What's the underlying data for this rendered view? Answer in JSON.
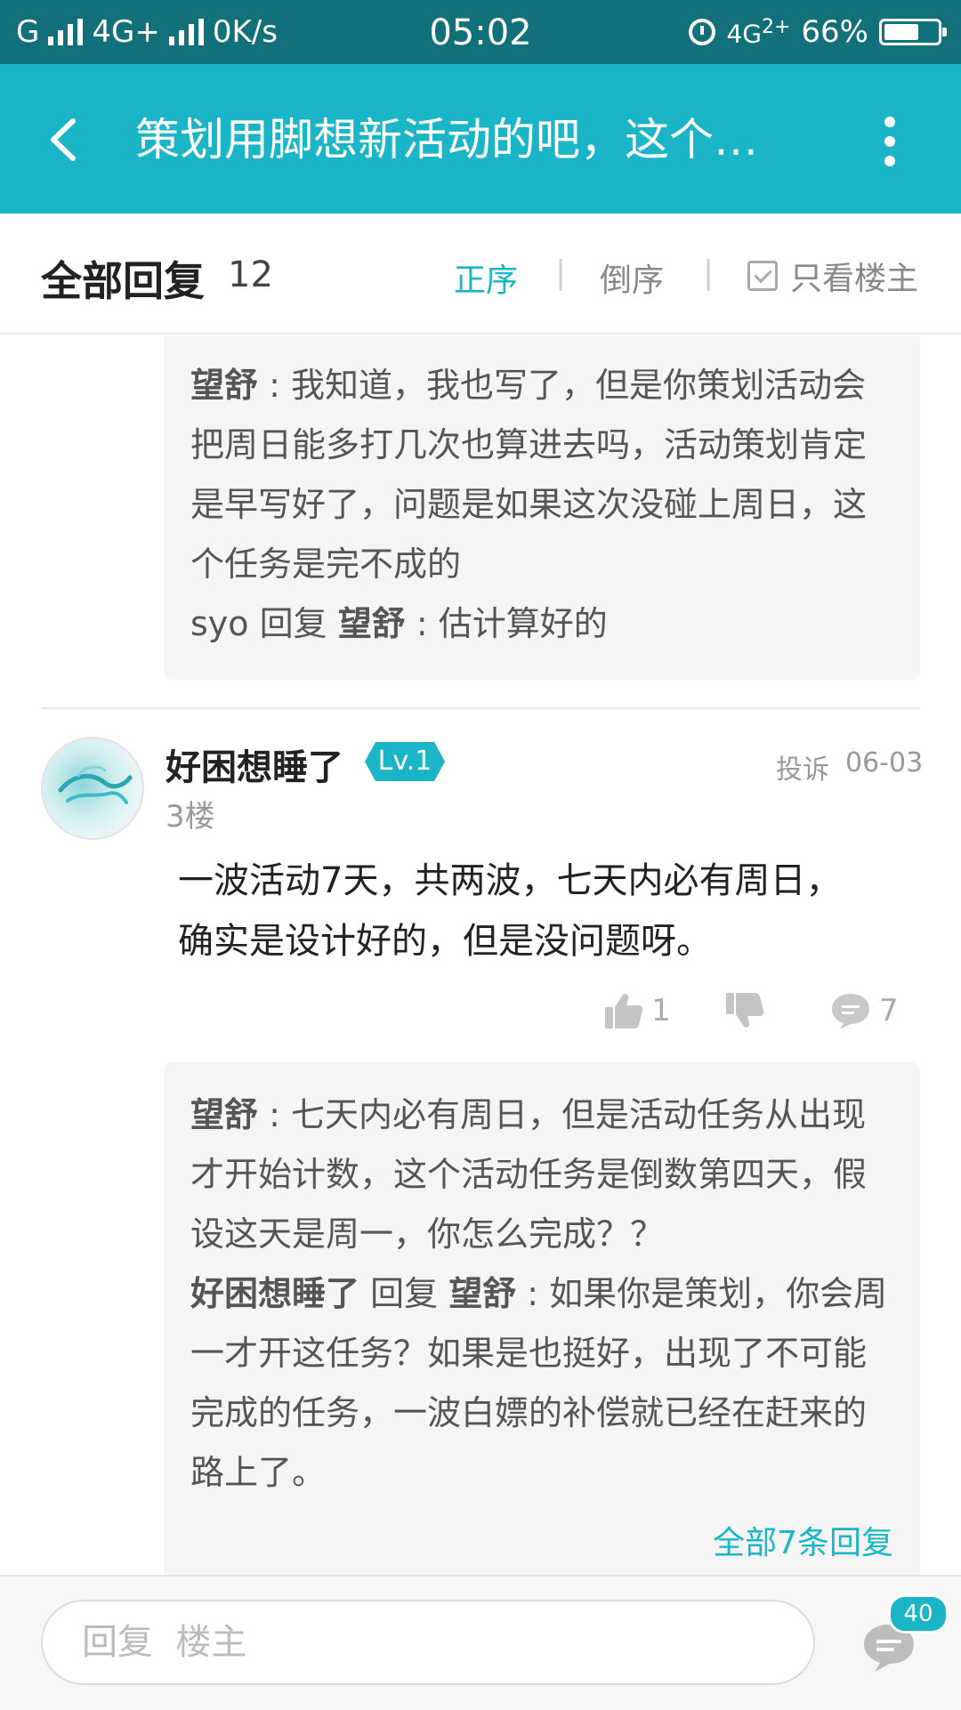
{
  "status_bar": {
    "carrier": "G",
    "network": "4G+",
    "speed": "0K/s",
    "time": "05:02",
    "network2": "4G",
    "network2_sup": "2+",
    "battery": "66%",
    "battery_level": 0.66
  },
  "toolbar": {
    "title": "策划用脚想新活动的吧，这个…",
    "back_icon": "back-arrow-icon",
    "more_icon": "more-vertical-icon"
  },
  "reply_header": {
    "title": "全部回复",
    "count": "12",
    "sort_asc": "正序",
    "sort_desc": "倒序",
    "separator": "|",
    "only_op": "只看楼主"
  },
  "prev_subreplies": {
    "r1_name": "望舒",
    "r1_text": " : 我知道，我也写了，但是你策划活动会把周日能多打几次也算进去吗，活动策划肯定是早写好了，问题是如果这次没碰上周日，这个任务是完不成的",
    "r2_name": "syo",
    "r2_mid": " 回复 ",
    "r2_target": "望舒",
    "r2_text": " : 估计算好的"
  },
  "floor3": {
    "username": "好困想睡了",
    "level": "Lv.1",
    "report": "投诉",
    "date": "06-03",
    "floor": "3楼",
    "content_line1": "一波活动7天，共两波，七天内必有周日，",
    "content_line2": "确实是设计好的，但是没问题呀。",
    "likes": "1",
    "comments": "7",
    "subreplies": {
      "r1_name": "望舒",
      "r1_text": " : 七天内必有周日，但是活动任务从出现才开始计数，这个活动任务是倒数第四天，假设这天是周一，你怎么完成？？",
      "r2_name": "好困想睡了",
      "r2_mid": " 回复 ",
      "r2_target": "望舒",
      "r2_text": " : 如果你是策划，你会周一才开这任务？如果是也挺好，出现了不可能完成的任务，一波白嫖的补偿就已经在赶来的路上了。",
      "all_replies": "全部7条回复"
    }
  },
  "bottom_bar": {
    "reply_placeholder": "回复  楼主",
    "message_badge": "40"
  },
  "colors": {
    "status_bar": "#12707a",
    "accent": "#1ab6c7"
  }
}
